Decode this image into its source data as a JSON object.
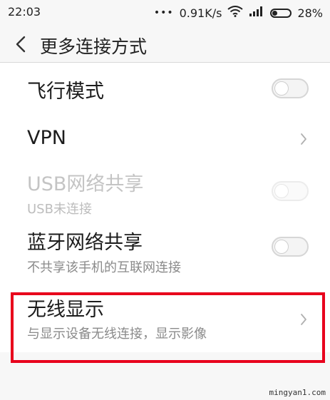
{
  "status_bar": {
    "time": "22:03",
    "dots": "•••",
    "network_speed": "0.91K/s",
    "battery_percent": "28%",
    "battery_level": 0.28,
    "icons": [
      "wifi-icon",
      "signal-icon",
      "battery-icon"
    ]
  },
  "header": {
    "back_icon": "chevron-left-icon",
    "title": "更多连接方式"
  },
  "settings": {
    "airplane_mode": {
      "title": "飞行模式",
      "enabled": false
    },
    "vpn": {
      "title": "VPN"
    },
    "usb_tethering": {
      "title": "USB网络共享",
      "subtitle": "USB未连接",
      "enabled": false,
      "disabled": true
    },
    "bluetooth_tethering": {
      "title": "蓝牙网络共享",
      "subtitle": "不共享该手机的互联网连接",
      "enabled": false
    },
    "wireless_display": {
      "title": "无线显示",
      "subtitle": "与显示设备无线连接，显示影像",
      "highlighted": true
    }
  },
  "colors": {
    "highlight_border": "#e8001c",
    "text_primary": "#1c1c1c",
    "text_secondary": "#8a8a8a",
    "text_disabled": "#c4c4c4"
  },
  "watermark": "mingyan1.com"
}
